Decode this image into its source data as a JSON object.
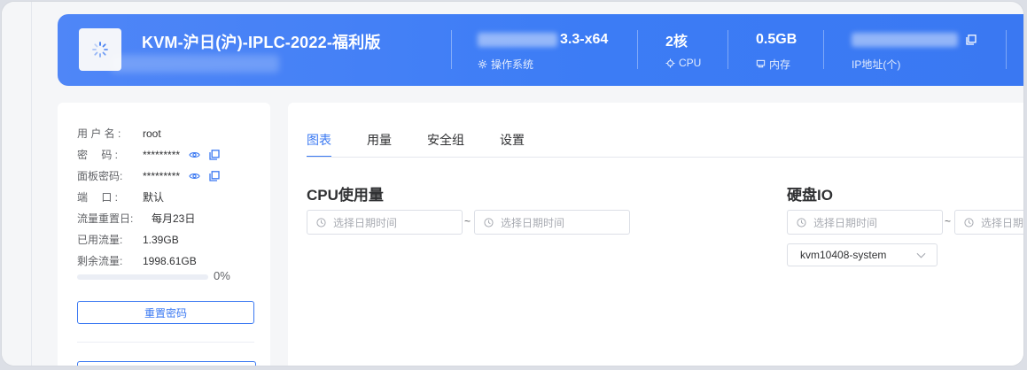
{
  "server": {
    "title": "KVM-沪日(沪)-IPLC-2022-福利版"
  },
  "stats": {
    "os": {
      "value": "3.3-x64",
      "label": "操作系统",
      "icon": "gear-icon"
    },
    "cpu": {
      "value": "2核",
      "label": "CPU",
      "icon": "cpu-icon"
    },
    "memory": {
      "value": "0.5GB",
      "label": "内存",
      "icon": "memory-icon"
    },
    "ip": {
      "label": "IP地址(个)",
      "icon": "copy-icon"
    }
  },
  "info": {
    "username_label": "用 户 名 :",
    "username": "root",
    "password_label": "密　 码 :",
    "password": "*********",
    "panel_password_label": "面板密码:",
    "panel_password": "*********",
    "port_label": "端　 口 :",
    "port": "默认",
    "reset_label": "流量重置日:",
    "reset_day": "每月23日",
    "used_label": "已用流量:",
    "used": "1.39GB",
    "remaining_label": "剩余流量:",
    "remaining": "1998.61GB",
    "usage_percent_text": "0%",
    "usage_fraction": 0.0,
    "reset_password_button": "重置密码"
  },
  "tabs": [
    "图表",
    "用量",
    "安全组",
    "设置"
  ],
  "active_tab": 0,
  "cpu_section": {
    "title": "CPU使用量",
    "start_placeholder": "选择日期时间",
    "end_placeholder": "选择日期时间",
    "separator": "~"
  },
  "disk_section": {
    "title": "硬盘IO",
    "start_placeholder": "选择日期时间",
    "end_placeholder": "选择日期时间",
    "separator": "~",
    "disk_select": "kvm10408-system"
  },
  "colors": {
    "accent": "#3a78f2",
    "banner_start": "#4f86f7",
    "banner_end": "#3a78f2"
  }
}
